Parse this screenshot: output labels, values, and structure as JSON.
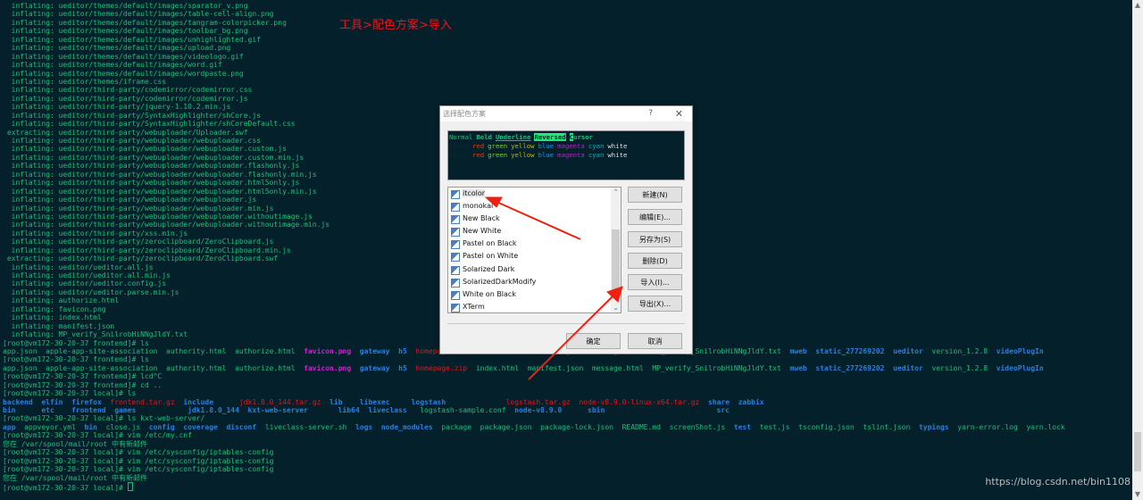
{
  "annotation": "工具>配色方案>导入",
  "watermark": "https://blog.csdn.net/bin1108",
  "colors": {
    "default": "#1cbf78",
    "blue": "#2a7ee0",
    "magenta": "#d21cd2",
    "red": "#e8141e",
    "background": "#04202a"
  },
  "terminal": {
    "lines": [
      "  inflating: ueditor/themes/default/images/sparator_v.png",
      "  inflating: ueditor/themes/default/images/table-cell-align.png",
      "  inflating: ueditor/themes/default/images/tangram-colorpicker.png",
      "  inflating: ueditor/themes/default/images/toolbar_bg.png",
      "  inflating: ueditor/themes/default/images/unhighlighted.gif",
      "  inflating: ueditor/themes/default/images/upload.png",
      "  inflating: ueditor/themes/default/images/videologo.gif",
      "  inflating: ueditor/themes/default/images/word.gif",
      "  inflating: ueditor/themes/default/images/wordpaste.png",
      "  inflating: ueditor/themes/iframe.css",
      "  inflating: ueditor/third-party/codemirror/codemirror.css",
      "  inflating: ueditor/third-party/codemirror/codemirror.js",
      "  inflating: ueditor/third-party/jquery-1.10.2.min.js",
      "  inflating: ueditor/third-party/SyntaxHighlighter/shCore.js",
      "  inflating: ueditor/third-party/SyntaxHighlighter/shCoreDefault.css",
      " extracting: ueditor/third-party/webuploader/Uploader.swf",
      "  inflating: ueditor/third-party/webuploader/webuploader.css",
      "  inflating: ueditor/third-party/webuploader/webuploader.custom.js",
      "  inflating: ueditor/third-party/webuploader/webuploader.custom.min.js",
      "  inflating: ueditor/third-party/webuploader/webuploader.flashonly.js",
      "  inflating: ueditor/third-party/webuploader/webuploader.flashonly.min.js",
      "  inflating: ueditor/third-party/webuploader/webuploader.html5only.js",
      "  inflating: ueditor/third-party/webuploader/webuploader.html5only.min.js",
      "  inflating: ueditor/third-party/webuploader/webuploader.js",
      "  inflating: ueditor/third-party/webuploader/webuploader.min.js",
      "  inflating: ueditor/third-party/webuploader/webuploader.withoutimage.js",
      "  inflating: ueditor/third-party/webuploader/webuploader.withoutimage.min.js",
      "  inflating: ueditor/third-party/xss.min.js",
      "  inflating: ueditor/third-party/zeroclipboard/ZeroClipboard.js",
      "  inflating: ueditor/third-party/zeroclipboard/ZeroClipboard.min.js",
      " extracting: ueditor/third-party/zeroclipboard/ZeroClipboard.swf",
      "  inflating: ueditor/ueditor.all.js",
      "  inflating: ueditor/ueditor.all.min.js",
      "  inflating: ueditor/ueditor.config.js",
      "  inflating: ueditor/ueditor.parse.min.js",
      "  inflating: authorize.html",
      "  inflating: favicon.png",
      "  inflating: index.html",
      "  inflating: manifest.json",
      "  inflating: MP_verify_SnilrobHiNNgJldY.txt",
      "[root@vm172-30-20-37 frontend]# ls",
      [
        [
          "app.json  apple-app-site-association  authority.html  authorize.html  ",
          "g"
        ],
        [
          "favicon.png",
          "m"
        ],
        [
          "  ",
          "g"
        ],
        [
          "gateway",
          "b"
        ],
        [
          "  ",
          "g"
        ],
        [
          "h5",
          "b"
        ],
        [
          "  ",
          "g"
        ],
        [
          "homepage.zip",
          "r"
        ],
        [
          "  index.html  manifest.json  message.html  MP_verify_SnilrobHiNNgJldY.txt  ",
          "g"
        ],
        [
          "mweb",
          "b"
        ],
        [
          "  ",
          "g"
        ],
        [
          "static_277269202",
          "b"
        ],
        [
          "  ",
          "g"
        ],
        [
          "ueditor",
          "b"
        ],
        [
          "  version_1.2.8  ",
          "g"
        ],
        [
          "videoPlugIn",
          "b"
        ]
      ],
      "[root@vm172-30-20-37 frontend]# ls",
      [
        [
          "app.json  apple-app-site-association  authority.html  authorize.html  ",
          "g"
        ],
        [
          "favicon.png",
          "m"
        ],
        [
          "  ",
          "g"
        ],
        [
          "gateway",
          "b"
        ],
        [
          "  ",
          "g"
        ],
        [
          "h5",
          "b"
        ],
        [
          "  ",
          "g"
        ],
        [
          "homepage.zip",
          "r"
        ],
        [
          "  index.html  manifest.json  message.html  MP_verify_SnilrobHiNNgJldY.txt  ",
          "g"
        ],
        [
          "mweb",
          "b"
        ],
        [
          "  ",
          "g"
        ],
        [
          "static_277269202",
          "b"
        ],
        [
          "  ",
          "g"
        ],
        [
          "ueditor",
          "b"
        ],
        [
          "  version_1.2.8  ",
          "g"
        ],
        [
          "videoPlugIn",
          "b"
        ]
      ],
      "[root@vm172-30-20-37 frontend]# lcd^C",
      "[root@vm172-30-20-37 frontend]# cd ..",
      "[root@vm172-30-20-37 local]# ls",
      [
        [
          "backend  elfin  firefox  ",
          "b"
        ],
        [
          "frontend.tar.gz",
          "r"
        ],
        [
          "  ",
          "g"
        ],
        [
          "include      ",
          "b"
        ],
        [
          "jdk1.8.0_144.tar.gz",
          "r"
        ],
        [
          "  ",
          "g"
        ],
        [
          "lib    libexec     logstash              ",
          "b"
        ],
        [
          "logstash.tar.gz",
          "r"
        ],
        [
          "  ",
          "g"
        ],
        [
          "node-v8.9.0-linux-x64.tar.gz",
          "r"
        ],
        [
          "  ",
          "g"
        ],
        [
          "share  zabbix",
          "b"
        ]
      ],
      [
        [
          "bin      etc    frontend  games            jdk1.8.0_144  kxt-web-server       lib64  liveclass   ",
          "b"
        ],
        [
          "logstash-sample.conf",
          "g"
        ],
        [
          "  ",
          "g"
        ],
        [
          "node-v8.9.0      sbin                          src",
          "b"
        ]
      ],
      "[root@vm172-30-20-37 local]# ls kxt-web-server/",
      [
        [
          "app",
          "b"
        ],
        [
          "  appveyor.yml  ",
          "g"
        ],
        [
          "bin",
          "b"
        ],
        [
          "  close.js  ",
          "g"
        ],
        [
          "config  coverage  disconf",
          "b"
        ],
        [
          "  liveclass-server.sh  ",
          "g"
        ],
        [
          "logs  node_modules",
          "b"
        ],
        [
          "  package  package.json  package-lock.json  README.md  screenShot.js  ",
          "g"
        ],
        [
          "test",
          "b"
        ],
        [
          "  test.js  tsconfig.json  tslint.json  ",
          "g"
        ],
        [
          "typings",
          "b"
        ],
        [
          "  yarn-error.log  yarn.lock",
          "g"
        ]
      ],
      "[root@vm172-30-20-37 local]# vim /etc/my.cnf",
      "您在 /var/spool/mail/root 中有新邮件",
      "[root@vm172-30-20-37 local]# vim /etc/sysconfig/iptables-config",
      "[root@vm172-30-20-37 local]# vim /etc/sysconfig/iptables-config",
      "[root@vm172-30-20-37 local]# vim /etc/sysconfig/iptables-config",
      "您在 /var/spool/mail/root 中有新邮件",
      "[root@vm172-30-20-37 local]# "
    ]
  },
  "dialog": {
    "title": "选择配色方案",
    "help": "?",
    "close": "✕",
    "preview": {
      "row1": [
        [
          "Normal",
          "#1cbf78"
        ],
        [
          "Bold",
          "#1cbf78"
        ],
        [
          "Underline",
          "#1cbf78"
        ],
        [
          "Reversed",
          "#04202a"
        ],
        [
          "Cursor",
          "#1cbf78"
        ]
      ],
      "row2": [
        [
          "black",
          "#0a2a30"
        ],
        [
          "red",
          "#e0401a"
        ],
        [
          "green",
          "#7ed321"
        ],
        [
          "yellow",
          "#c8b400"
        ],
        [
          "blue",
          "#1a8ee0"
        ],
        [
          "magenta",
          "#c41cc4"
        ],
        [
          "cyan",
          "#1aa8b8"
        ],
        [
          "white",
          "#e0e0e0"
        ]
      ],
      "row3": [
        [
          "black",
          "#0a2a30"
        ],
        [
          "red",
          "#e0401a"
        ],
        [
          "green",
          "#7ed321"
        ],
        [
          "yellow",
          "#c8b400"
        ],
        [
          "blue",
          "#1a8ee0"
        ],
        [
          "magenta",
          "#c41cc4"
        ],
        [
          "cyan",
          "#1aa8b8"
        ],
        [
          "white",
          "#e0e0e0"
        ]
      ]
    },
    "schemes": [
      "itcolor",
      "monokai",
      "New Black",
      "New White",
      "Pastel on Black",
      "Pastel on White",
      "Solarized Dark",
      "SolarizedDarkModify",
      "White on Black",
      "XTerm"
    ],
    "selected": "itcolor",
    "buttons": {
      "new": "新建(N)",
      "edit": "编辑(E)...",
      "save_as": "另存为(S)",
      "delete": "删除(D)",
      "import": "导入(I)...",
      "export": "导出(X)...",
      "ok": "确定",
      "cancel": "取消"
    }
  }
}
